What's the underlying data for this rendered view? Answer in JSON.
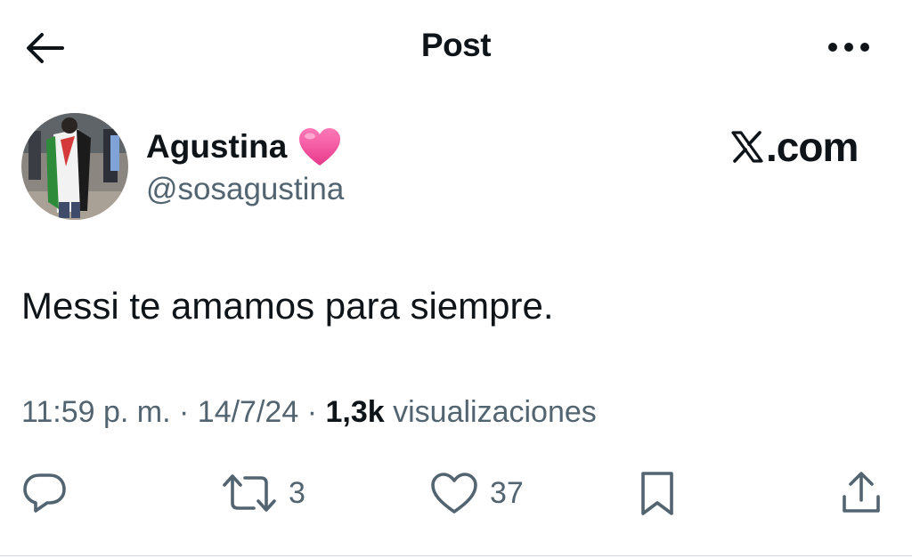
{
  "header": {
    "title": "Post",
    "back_icon": "arrow-left-icon",
    "more_icon": "more-horizontal-icon"
  },
  "author": {
    "display_name": "Agustina",
    "emoji": "pink-heart-emoji",
    "handle": "@sosagustina",
    "avatar_icon": "avatar-photo"
  },
  "watermark": {
    "logo": "x-logo-icon",
    "text": ".com"
  },
  "tweet": {
    "text": "Messi te amamos para siempre."
  },
  "meta": {
    "time": "11:59 p. m.",
    "sep1": " · ",
    "date": "14/7/24",
    "sep2": " · ",
    "views_count": "1,3k",
    "views_label": " visualizaciones"
  },
  "actions": {
    "reply_icon": "reply-icon",
    "retweet_icon": "retweet-icon",
    "retweet_count": "3",
    "like_icon": "heart-icon",
    "like_count": "37",
    "bookmark_icon": "bookmark-icon",
    "share_icon": "share-icon"
  },
  "colors": {
    "text": "#0f1419",
    "secondary": "#536471",
    "heart_emoji": "#f0559c"
  }
}
